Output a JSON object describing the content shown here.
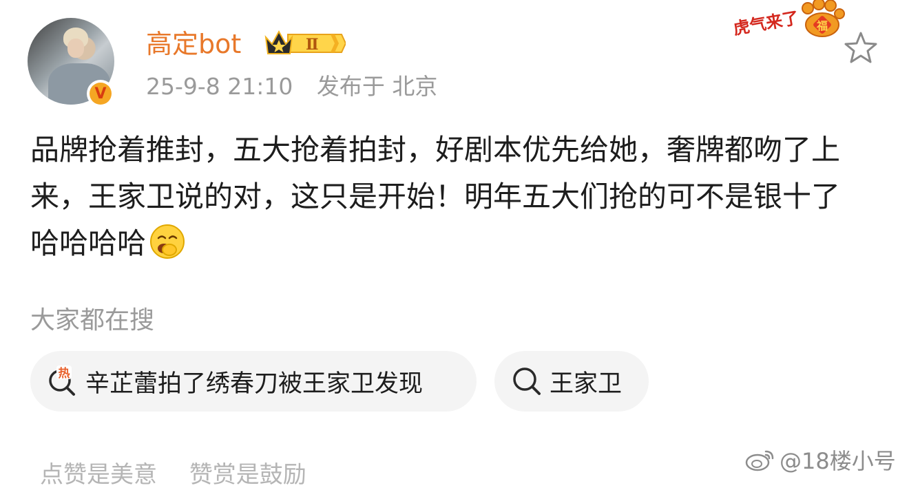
{
  "header": {
    "username": "高定bot",
    "level_badge": "Ⅱ",
    "verified_badge": "V",
    "timestamp": "25-9-8 21:10",
    "location": "发布于 北京",
    "sticker_text": "虎气来了",
    "sticker_tag": "福"
  },
  "post": {
    "text": "品牌抢着推封，五大抢着拍封，好剧本优先给她，奢牌都吻了上来，王家卫说的对，这只是开始！明年五大们抢的可不是银十了哈哈哈哈",
    "emoji": "laughing-emoji"
  },
  "search": {
    "title": "大家都在搜",
    "chips": [
      {
        "label": "辛芷蕾拍了绣春刀被王家卫发现",
        "icon": "hot-search-icon",
        "tag": "热"
      },
      {
        "label": "王家卫",
        "icon": "search-icon"
      }
    ]
  },
  "footer": {
    "like_text": "点赞是美意",
    "reward_text": "赞赏是鼓励",
    "watermark": "@18楼小号"
  },
  "colors": {
    "username": "#e8782a",
    "meta": "#9a9a9a",
    "chip_bg": "#f4f4f4",
    "hot_red": "#e8602c",
    "badge_gold": "#f5a623"
  }
}
